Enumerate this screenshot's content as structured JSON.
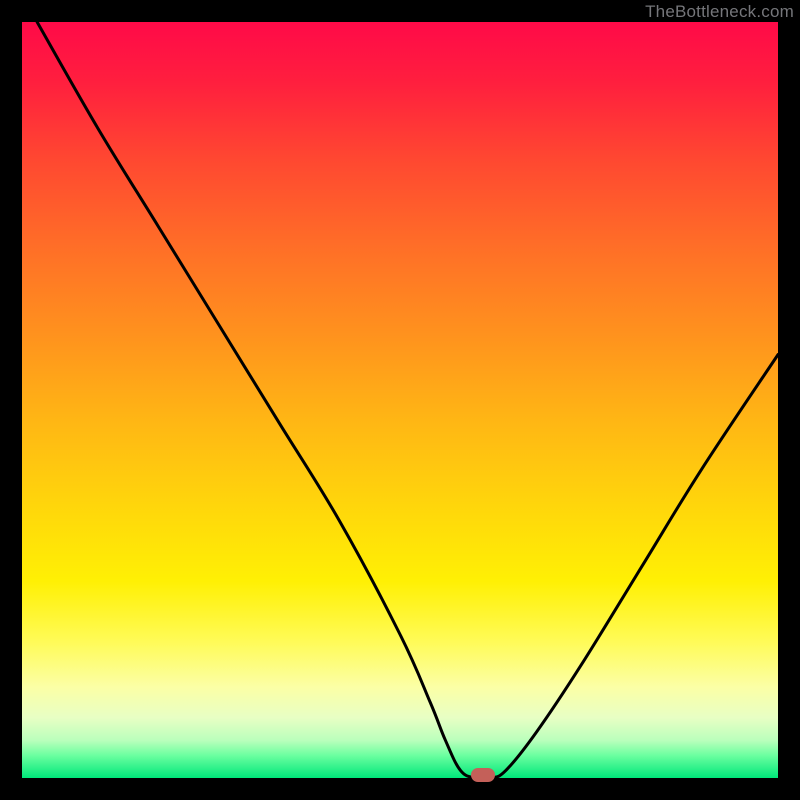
{
  "watermark": "TheBottleneck.com",
  "chart_data": {
    "type": "line",
    "title": "",
    "xlabel": "",
    "ylabel": "",
    "xlim": [
      0,
      100
    ],
    "ylim": [
      0,
      100
    ],
    "series": [
      {
        "name": "curve",
        "x": [
          2,
          10,
          18,
          26,
          34,
          42,
          50,
          54,
          56,
          58,
          60,
          62,
          64,
          68,
          74,
          82,
          90,
          100
        ],
        "values": [
          100,
          86,
          73,
          60,
          47,
          34,
          19,
          10,
          5,
          1,
          0,
          0,
          1,
          6,
          15,
          28,
          41,
          56
        ]
      }
    ],
    "marker": {
      "x": 61,
      "y": 0.4
    },
    "gradient_stops": [
      {
        "pos": 0,
        "color": "#ff0a48"
      },
      {
        "pos": 18,
        "color": "#ff4731"
      },
      {
        "pos": 42,
        "color": "#ff941d"
      },
      {
        "pos": 64,
        "color": "#ffd60b"
      },
      {
        "pos": 82,
        "color": "#fffb58"
      },
      {
        "pos": 95,
        "color": "#bbffbc"
      },
      {
        "pos": 100,
        "color": "#00e77a"
      }
    ]
  }
}
